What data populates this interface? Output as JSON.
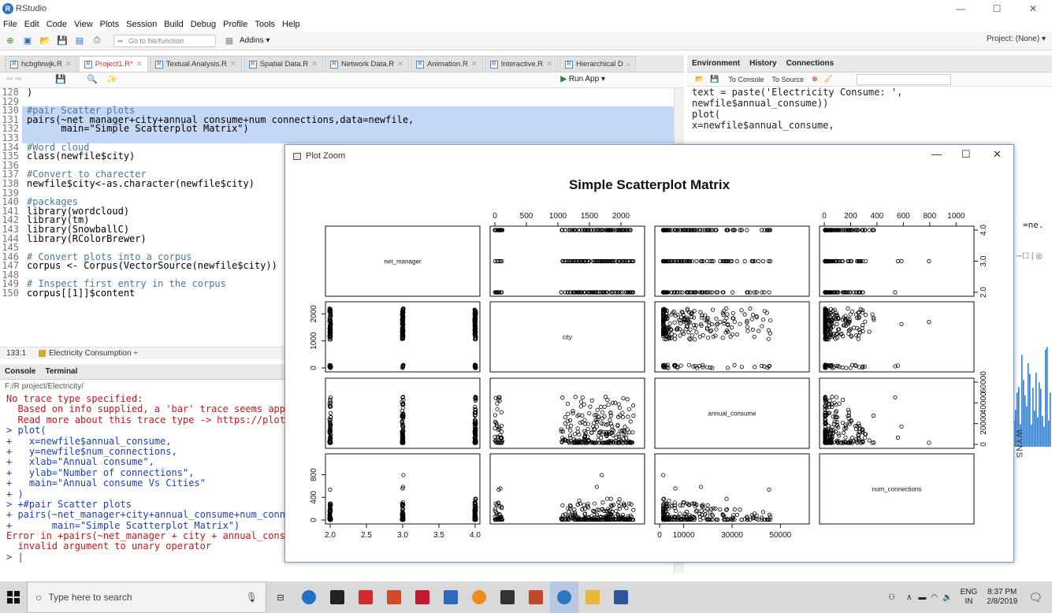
{
  "window": {
    "title": "RStudio"
  },
  "menu": [
    "File",
    "Edit",
    "Code",
    "View",
    "Plots",
    "Session",
    "Build",
    "Debug",
    "Profile",
    "Tools",
    "Help"
  ],
  "toolbar": {
    "goto_placeholder": "Go to file/function",
    "addins": "Addins ▾",
    "project": "Project: (None) ▾"
  },
  "editor": {
    "tabs": [
      {
        "label": "hcbgfewjk.R"
      },
      {
        "label": "Project1.R*",
        "active": true
      },
      {
        "label": "Textual Analysis.R"
      },
      {
        "label": "Spatial Data.R"
      },
      {
        "label": "Network Data.R"
      },
      {
        "label": "Animation.R"
      },
      {
        "label": "Interactive.R"
      },
      {
        "label": "Hierarchical D"
      }
    ],
    "run_app": "Run App",
    "status_position": "133:1",
    "status_context": "Electricity Consumption ÷",
    "lines": [
      {
        "n": "128",
        "t": ")",
        "c": ""
      },
      {
        "n": "129",
        "t": "",
        "c": ""
      },
      {
        "n": "130",
        "t": "#pair Scatter plots",
        "c": "cm",
        "sel": true
      },
      {
        "n": "131",
        "t": "pairs(~net_manager+city+annual_consume+num_connections,data=newfile,",
        "c": "",
        "sel": true
      },
      {
        "n": "132",
        "t": "      main=\"Simple Scatterplot Matrix\")",
        "c": "",
        "sel": true
      },
      {
        "n": "133",
        "t": "",
        "c": "",
        "sel": true
      },
      {
        "n": "134",
        "t": "#Word cloud",
        "c": "cm"
      },
      {
        "n": "135",
        "t": "class(newfile$city)",
        "c": ""
      },
      {
        "n": "136",
        "t": "",
        "c": ""
      },
      {
        "n": "137",
        "t": "#Convert to charecter",
        "c": "cm"
      },
      {
        "n": "138",
        "t": "newfile$city<-as.character(newfile$city)",
        "c": ""
      },
      {
        "n": "139",
        "t": "",
        "c": ""
      },
      {
        "n": "140",
        "t": "#packages",
        "c": "cm"
      },
      {
        "n": "141",
        "t": "library(wordcloud)",
        "c": ""
      },
      {
        "n": "142",
        "t": "library(tm)",
        "c": ""
      },
      {
        "n": "143",
        "t": "library(SnowballC)",
        "c": ""
      },
      {
        "n": "144",
        "t": "library(RColorBrewer)",
        "c": ""
      },
      {
        "n": "145",
        "t": "",
        "c": ""
      },
      {
        "n": "146",
        "t": "# Convert plots into a corpus",
        "c": "cm"
      },
      {
        "n": "147",
        "t": "corpus <- Corpus(VectorSource(newfile$city))",
        "c": ""
      },
      {
        "n": "148",
        "t": "",
        "c": ""
      },
      {
        "n": "149",
        "t": "# Inspect first entry in the corpus",
        "c": "cm"
      },
      {
        "n": "150",
        "t": "corpus[[1]]$content",
        "c": ""
      }
    ]
  },
  "console": {
    "tabs": [
      "Console",
      "Terminal"
    ],
    "path": "F:/R project/Electricity/",
    "lines": [
      {
        "t": "No trace type specified:",
        "c": "err"
      },
      {
        "t": "  Based on info supplied, a 'bar' trace seems appr",
        "c": "err"
      },
      {
        "t": "  Read more about this trace type -> https://plot.",
        "c": "err"
      },
      {
        "t": "> plot(",
        "c": "in"
      },
      {
        "t": "+   x=newfile$annual_consume,",
        "c": "in"
      },
      {
        "t": "+   y=newfile$num_connections,",
        "c": "in"
      },
      {
        "t": "+   xlab=\"Annual consume\",",
        "c": "in"
      },
      {
        "t": "+   ylab=\"Number of connections\",",
        "c": "in"
      },
      {
        "t": "+   main=\"Annual consume Vs Cities\"",
        "c": "in"
      },
      {
        "t": "+ )",
        "c": "in"
      },
      {
        "t": "> +#pair Scatter plots",
        "c": "in"
      },
      {
        "t": "+ pairs(~net_manager+city+annual_consume+num_conne",
        "c": "in"
      },
      {
        "t": "+       main=\"Simple Scatterplot Matrix\")",
        "c": "in"
      },
      {
        "t": "Error in +pairs(~net_manager + city + annual_consu",
        "c": "err"
      },
      {
        "t": "  invalid argument to unary operator",
        "c": "err"
      },
      {
        "t": "> |",
        "c": "in"
      }
    ]
  },
  "environment": {
    "tabs": [
      "Environment",
      "History",
      "Connections"
    ],
    "to_console": "To Console",
    "to_source": "To Source",
    "history_lines": [
      "text = paste('Electricity Consume: ',",
      "newfile$annual_consume))",
      "plot(",
      "x=newfile$annual_consume,"
    ],
    "truncated": "=ne.",
    "side_label": "WYNS"
  },
  "plot_zoom": {
    "window_title": "Plot Zoom",
    "chart_data": {
      "type": "scatter",
      "title": "Simple Scatterplot Matrix",
      "variables": [
        "net_manager",
        "city",
        "annual_consume",
        "num_connections"
      ],
      "axes": {
        "net_manager": {
          "ticks": [
            "2.0",
            "2.5",
            "3.0",
            "3.5",
            "4.0"
          ],
          "range": [
            2,
            4
          ]
        },
        "city": {
          "ticks": [
            "0",
            "500",
            "1000",
            "1500",
            "2000"
          ],
          "range": [
            0,
            2300
          ]
        },
        "annual_consume": {
          "ticks": [
            "0",
            "10000",
            "30000",
            "50000"
          ],
          "range": [
            0,
            60000
          ]
        },
        "num_connections": {
          "ticks": [
            "0",
            "200",
            "400",
            "600",
            "800",
            "1000"
          ],
          "range": [
            0,
            1100
          ]
        }
      },
      "left_ticks": {
        "city": [
          "0",
          "1000",
          "2000"
        ],
        "num_connections": [
          "0",
          "400",
          "800"
        ]
      },
      "right_ticks": {
        "net_manager": [
          "2.0",
          "3.0",
          "4.0"
        ],
        "annual_consume": [
          "0",
          "20000",
          "50000"
        ]
      },
      "right_ticks_alt": {
        "annual_consume": [
          "0",
          "20000",
          "40000",
          "60000"
        ]
      },
      "grid": false,
      "legend": "none"
    }
  },
  "taskbar": {
    "search_placeholder": "Type here to search",
    "lang": "ENG",
    "region": "IN",
    "time": "8:37 PM",
    "date": "2/8/2019"
  }
}
